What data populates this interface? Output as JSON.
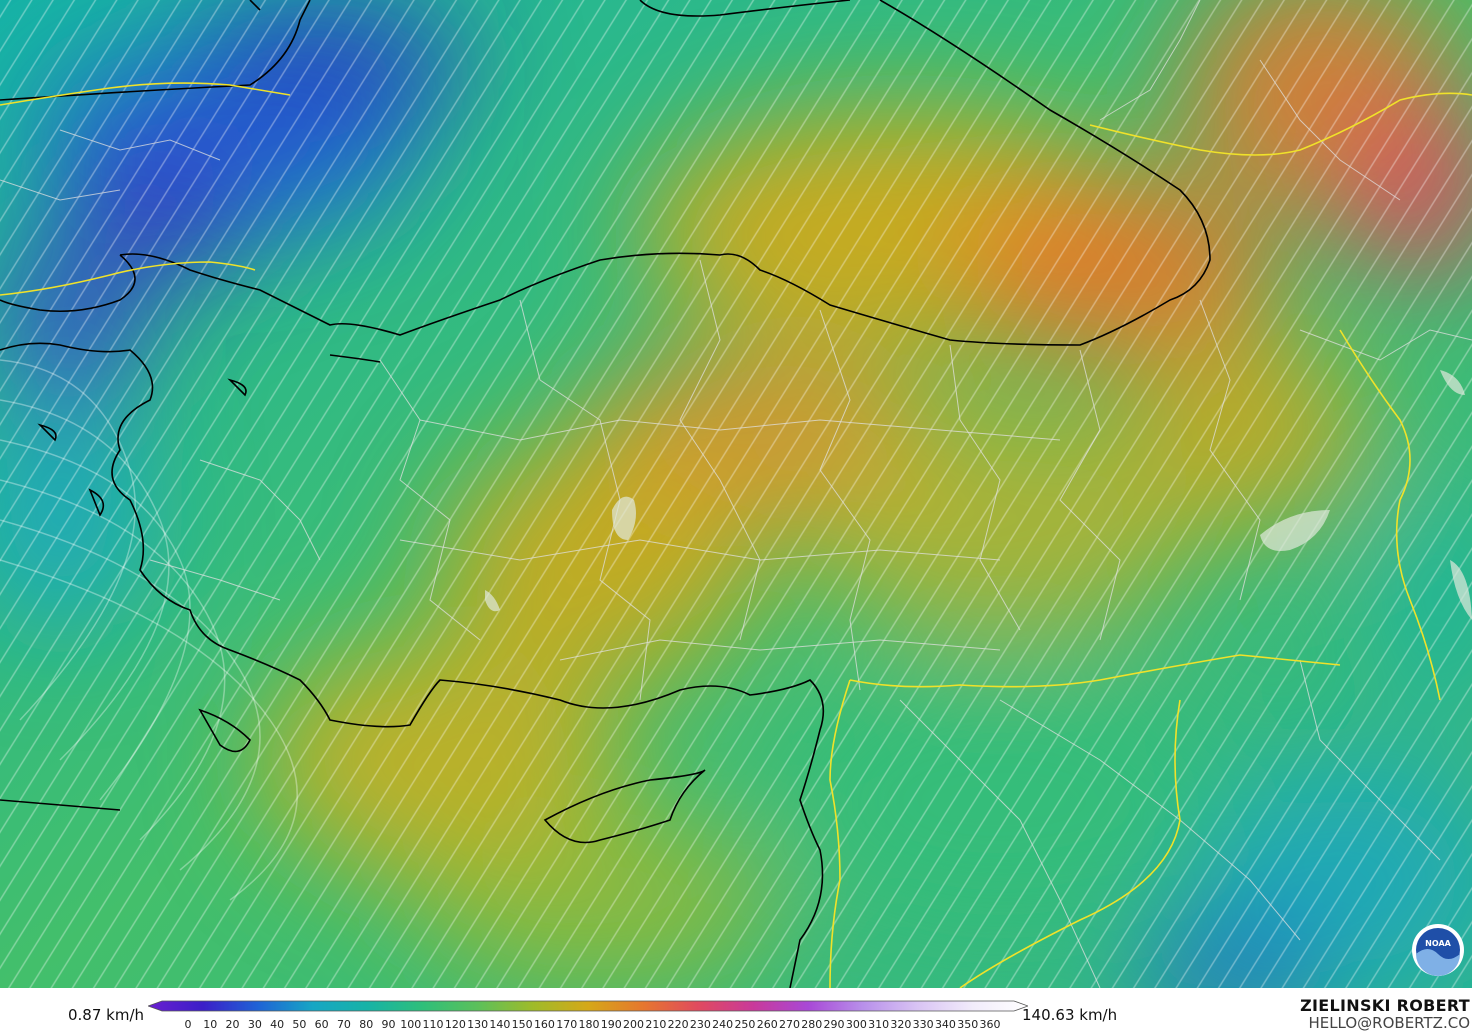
{
  "map": {
    "region": "Turkey / Eastern Mediterranean wind speed map",
    "colors": {
      "very_low": "#3b1fc8",
      "low": "#1f63d6",
      "mid_low": "#17b3a6",
      "mid": "#2fbf7a",
      "mid_high": "#9fbb2a",
      "high": "#d5a818",
      "very_high": "#e6772e",
      "extreme": "#e04a5f",
      "coastline": "#000000",
      "border": "#d8d8d8",
      "country_border": "#f0e22a",
      "streamline": "#ffffff"
    },
    "logo_icon": "noaa-logo"
  },
  "colorbar": {
    "min_label": "0.87 km/h",
    "max_label": "140.63 km/h",
    "ticks": [
      "0",
      "10",
      "20",
      "30",
      "40",
      "50",
      "60",
      "70",
      "80",
      "90",
      "100",
      "110",
      "120",
      "130",
      "140",
      "150",
      "160",
      "170",
      "180",
      "190",
      "200",
      "210",
      "220",
      "230",
      "240",
      "250",
      "260",
      "270",
      "280",
      "290",
      "300",
      "310",
      "320",
      "330",
      "340",
      "350",
      "360"
    ],
    "gradient": [
      "#6a1fd0",
      "#3b1fc8",
      "#1f63d6",
      "#17a6c4",
      "#17b3a6",
      "#2fbf7a",
      "#5cc05a",
      "#9fbb2a",
      "#d5a818",
      "#e6772e",
      "#e04a5f",
      "#c93a9a",
      "#a848d6",
      "#b890ea",
      "#d9c4f4",
      "#f2ecfb",
      "#ffffff"
    ]
  },
  "credit": {
    "name": "ZIELINSKI ROBERT",
    "email": "HELLO@ROBERTZ.CO"
  }
}
